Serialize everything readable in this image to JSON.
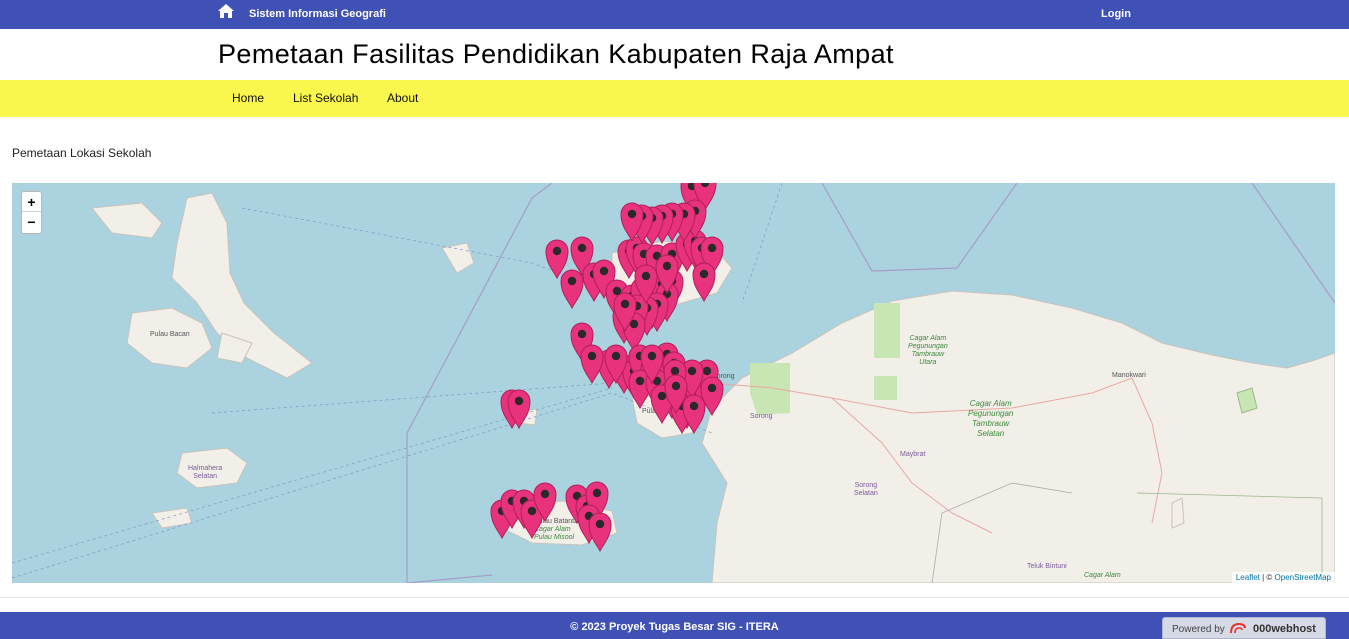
{
  "topbar": {
    "home_icon": "home-icon",
    "brand": "Sistem Informasi Geografi",
    "login_label": "Login"
  },
  "header": {
    "title": "Pemetaan Fasilitas Pendidikan Kabupaten Raja Ampat"
  },
  "nav": {
    "items": [
      "Home",
      "List Sekolah",
      "About"
    ]
  },
  "main": {
    "section_label": "Pemetaan Lokasi Sekolah"
  },
  "map": {
    "zoom_in": "+",
    "zoom_out": "−",
    "attribution_leaflet": "Leaflet",
    "attribution_sep": " | © ",
    "attribution_osm": "OpenStreetMap",
    "labels": {
      "pulau_bacan": "Pulau Bacan",
      "halmahera": "Halmahera\nSelatan",
      "cagar1": "Cagar Alam\nPegunungan\nTambrauw\nUtara",
      "cagar2": "Cagar Alam\nPegunungan\nTambrauw\nSelatan",
      "manokwari": "Manokwari",
      "sorong": "Sorong",
      "sorong_kab": "Sorong",
      "maybrat": "Maybrat",
      "sorong_selatan": "Sorong\nSelatan",
      "pulau": "Pulau",
      "teluk_bintuni": "Teluk Bintuni",
      "cagar_alam": "Cagar Alam",
      "pulau_batanta": "Pulau Batanta",
      "cagar_misool": "Cagar Alam",
      "pulau_misool": "Pulau Misool"
    },
    "marker_color": "#e8327c",
    "marker_count": 92
  },
  "footer": {
    "text": "© 2023 Proyek Tugas Besar SIG - ITERA",
    "powered_label": "Powered by",
    "powered_brand": "000webhost"
  },
  "colors": {
    "bar": "#3f51b5",
    "nav": "#f9f74e",
    "water": "#aad3df",
    "land": "#f2efe9",
    "park": "#c8e6b4"
  }
}
